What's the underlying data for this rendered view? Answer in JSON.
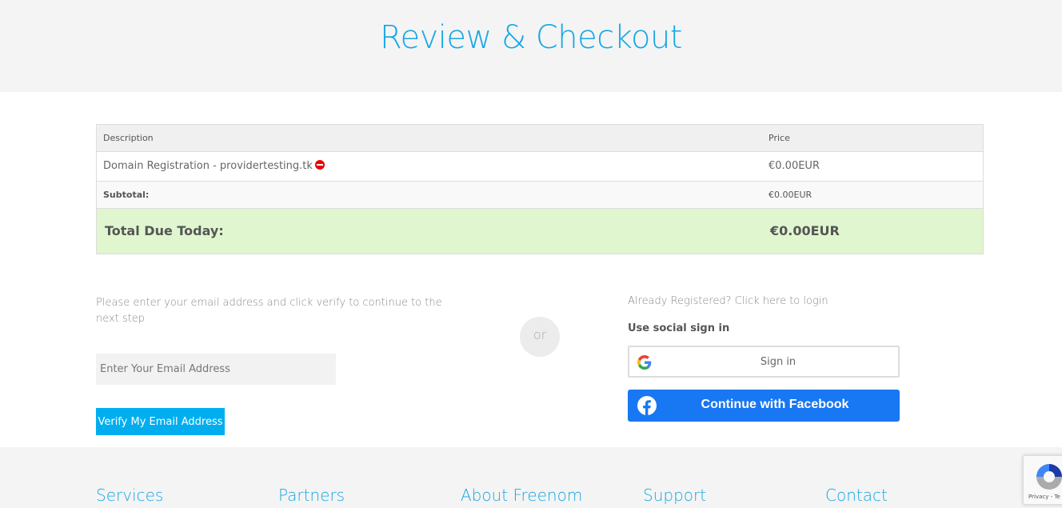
{
  "header": {
    "title": "Review & Checkout"
  },
  "cart": {
    "columns": [
      "Description",
      "Price"
    ],
    "items": [
      {
        "description": "Domain Registration - providertesting.tk",
        "price": "€0.00EUR",
        "remove_icon": "remove-icon"
      }
    ],
    "subtotal_label": "Subtotal:",
    "subtotal_value": "€0.00EUR",
    "total_label": "Total Due Today:",
    "total_value": "€0.00EUR"
  },
  "email_verify": {
    "info": "Please enter your email address and click verify to continue to the next step",
    "input_placeholder": "Enter Your Email Address",
    "input_value": "",
    "verify_button": "Verify My Email Address"
  },
  "divider": {
    "or_label": "or"
  },
  "login": {
    "already_registered": "Already Registered? Click here to login",
    "social_label": "Use social sign in",
    "google_button": "Sign in",
    "facebook_button": "Continue with Facebook"
  },
  "footer": {
    "headings": [
      "Services",
      "Partners",
      "About Freenom",
      "Support",
      "Contact"
    ]
  },
  "recaptcha": {
    "text": "Privacy - Te"
  },
  "colors": {
    "accent": "#15a7e5",
    "verify_button": "#00aeef",
    "facebook": "#1877f2",
    "total_row": "#dff6cf",
    "remove": "#ee0000"
  }
}
